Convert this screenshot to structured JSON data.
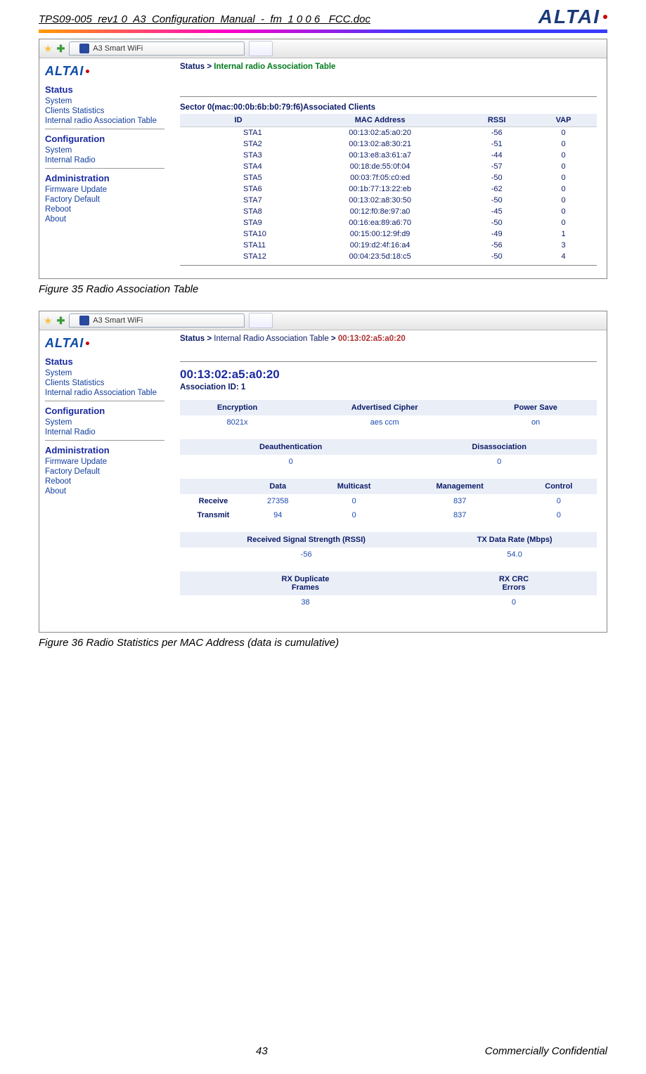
{
  "doc": {
    "header_title": "TPS09-005_rev1 0_A3_Configuration_Manual_-_fm_1 0 0 6 _FCC.doc",
    "brand": "ALTAI",
    "page_number": "43",
    "confidential": "Commercially Confidential"
  },
  "fig35": {
    "caption": "Figure 35     Radio Association Table",
    "tab_title": "A3 Smart WiFi",
    "sidebar_brand": "ALTAI",
    "nav": {
      "status_title": "Status",
      "status_items": [
        "System",
        "Clients Statistics",
        "Internal radio Association Table"
      ],
      "config_title": "Configuration",
      "config_items": [
        "System",
        "Internal Radio"
      ],
      "admin_title": "Administration",
      "admin_items": [
        "Firmware Update",
        "Factory Default",
        "Reboot",
        "About"
      ]
    },
    "breadcrumb": {
      "lead": "Status >",
      "current": "Internal radio Association Table"
    },
    "sector_title": "Sector 0(mac:00:0b:6b:b0:79:f6)Associated Clients",
    "columns": {
      "id": "ID",
      "mac": "MAC Address",
      "rssi": "RSSI",
      "vap": "VAP"
    },
    "rows": [
      {
        "id": "STA1",
        "mac": "00:13:02:a5:a0:20",
        "rssi": "-56",
        "vap": "0"
      },
      {
        "id": "STA2",
        "mac": "00:13:02:a8:30:21",
        "rssi": "-51",
        "vap": "0"
      },
      {
        "id": "STA3",
        "mac": "00:13:e8:a3:61:a7",
        "rssi": "-44",
        "vap": "0"
      },
      {
        "id": "STA4",
        "mac": "00:18:de:55:0f:04",
        "rssi": "-57",
        "vap": "0"
      },
      {
        "id": "STA5",
        "mac": "00:03:7f:05:c0:ed",
        "rssi": "-50",
        "vap": "0"
      },
      {
        "id": "STA6",
        "mac": "00:1b:77:13:22:eb",
        "rssi": "-62",
        "vap": "0"
      },
      {
        "id": "STA7",
        "mac": "00:13:02:a8:30:50",
        "rssi": "-50",
        "vap": "0"
      },
      {
        "id": "STA8",
        "mac": "00:12:f0:8e:97:a0",
        "rssi": "-45",
        "vap": "0"
      },
      {
        "id": "STA9",
        "mac": "00:16:ea:89:a6:70",
        "rssi": "-50",
        "vap": "0"
      },
      {
        "id": "STA10",
        "mac": "00:15:00:12:9f:d9",
        "rssi": "-49",
        "vap": "1"
      },
      {
        "id": "STA11",
        "mac": "00:19:d2:4f:16:a4",
        "rssi": "-56",
        "vap": "3"
      },
      {
        "id": "STA12",
        "mac": "00:04:23:5d:18:c5",
        "rssi": "-50",
        "vap": "4"
      }
    ]
  },
  "fig36": {
    "caption": "Figure 36     Radio Statistics per MAC Address (data is cumulative)",
    "tab_title": "A3 Smart WiFi",
    "sidebar_brand": "ALTAI",
    "nav": {
      "status_title": "Status",
      "status_items": [
        "System",
        "Clients Statistics",
        "Internal radio Association Table"
      ],
      "config_title": "Configuration",
      "config_items": [
        "System",
        "Internal Radio"
      ],
      "admin_title": "Administration",
      "admin_items": [
        "Firmware Update",
        "Factory Default",
        "Reboot",
        "About"
      ]
    },
    "breadcrumb": {
      "lead": "Status >",
      "mid": "Internal Radio Association Table",
      "sep": ">",
      "mac": "00:13:02:a5:a0:20"
    },
    "mac_big": "00:13:02:a5:a0:20",
    "assoc_id": "Association ID: 1",
    "t1": {
      "h": {
        "enc": "Encryption",
        "adv": "Advertised Cipher",
        "ps": "Power Save"
      },
      "r": {
        "enc": "8021x",
        "adv": "aes ccm",
        "ps": "on"
      }
    },
    "t2": {
      "h": {
        "deauth": "Deauthentication",
        "disassoc": "Disassociation"
      },
      "r": {
        "deauth": "0",
        "disassoc": "0"
      }
    },
    "t3": {
      "h": {
        "blank": "",
        "data": "Data",
        "multi": "Multicast",
        "mgmt": "Management",
        "ctrl": "Control"
      },
      "rows": [
        {
          "label": "Receive",
          "data": "27358",
          "multi": "0",
          "mgmt": "837",
          "ctrl": "0"
        },
        {
          "label": "Transmit",
          "data": "94",
          "multi": "0",
          "mgmt": "837",
          "ctrl": "0"
        }
      ]
    },
    "t4": {
      "h": {
        "rssi": "Received Signal Strength (RSSI)",
        "tx": "TX Data Rate (Mbps)"
      },
      "r": {
        "rssi": "-56",
        "tx": "54.0"
      }
    },
    "t5": {
      "h": {
        "dup": "RX Duplicate\nFrames",
        "crc": "RX CRC\nErrors"
      },
      "r": {
        "dup": "38",
        "crc": "0"
      }
    }
  }
}
